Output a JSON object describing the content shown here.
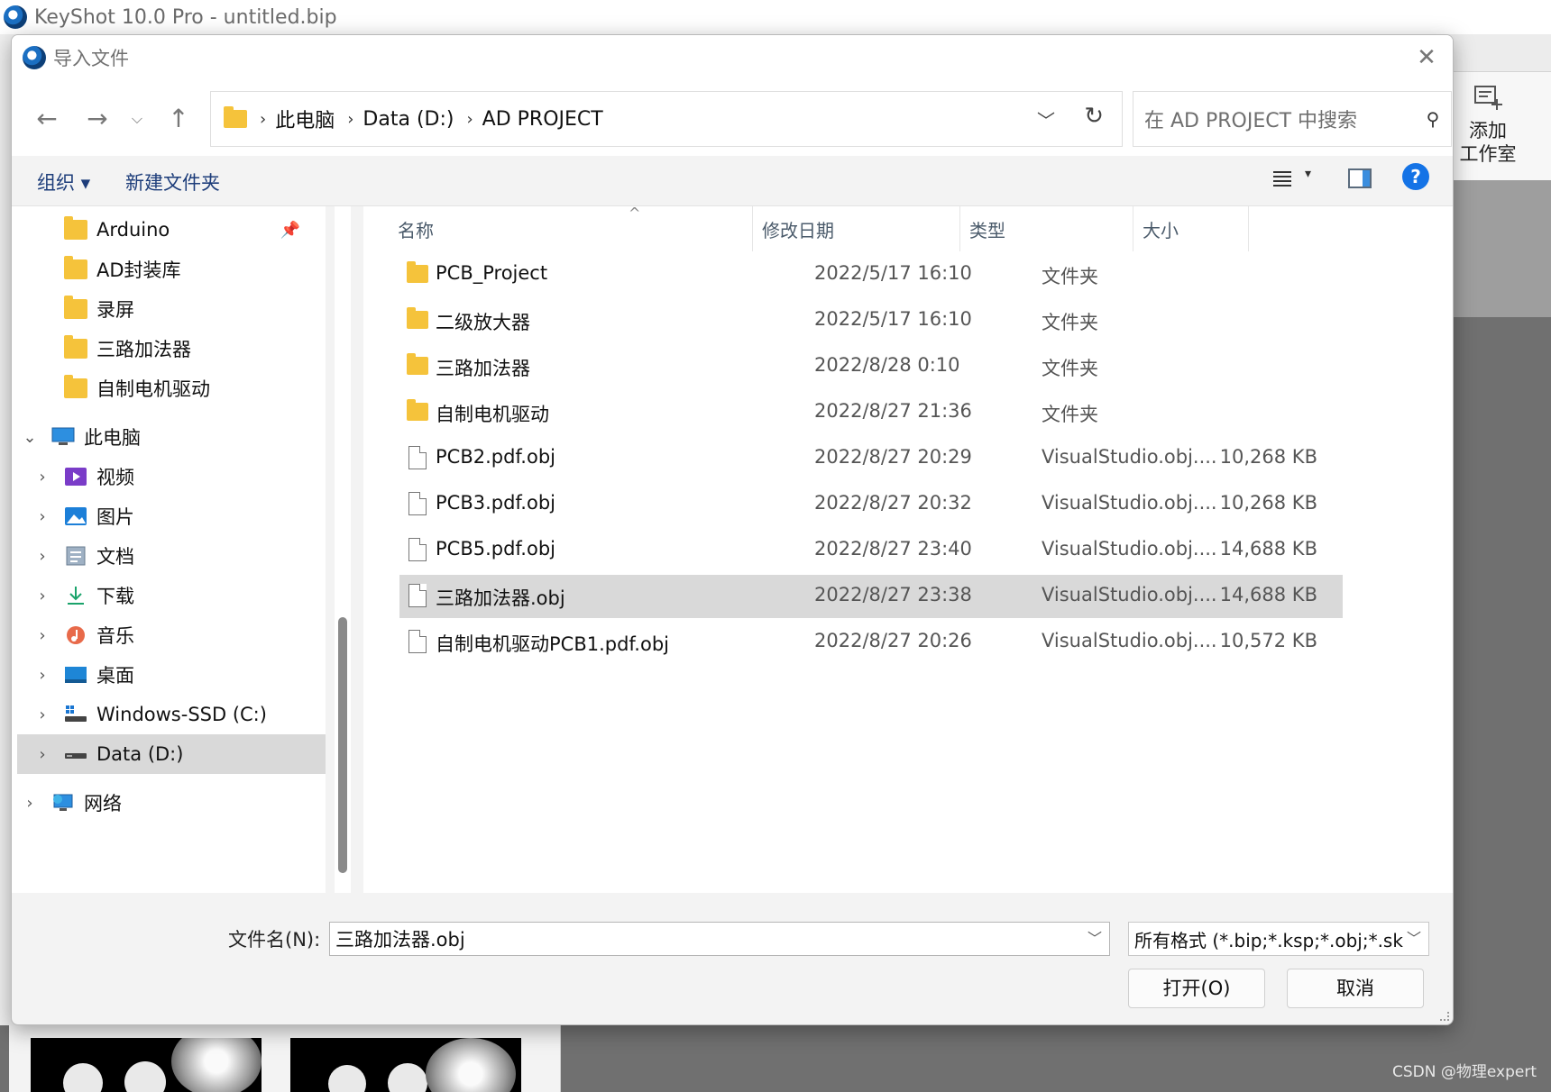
{
  "app": {
    "title": "KeyShot 10.0 Pro  - untitled.bip",
    "add_studio_label_1": "添加",
    "add_studio_label_2": "工作室",
    "watermark": "CSDN @物理expert"
  },
  "dialog": {
    "title": "导入文件",
    "breadcrumb": [
      "此电脑",
      "Data (D:)",
      "AD PROJECT"
    ],
    "search_placeholder": "在 AD PROJECT 中搜索",
    "commands": {
      "organize": "组织 ▾",
      "new_folder": "新建文件夹"
    },
    "nav_tree": [
      {
        "label": "Arduino",
        "icon": "folder-icon",
        "pinned": true
      },
      {
        "label": "AD封装库",
        "icon": "folder-icon"
      },
      {
        "label": "录屏",
        "icon": "folder-icon"
      },
      {
        "label": "三路加法器",
        "icon": "folder-icon"
      },
      {
        "label": "自制电机驱动",
        "icon": "folder-icon"
      },
      {
        "label": "此电脑",
        "icon": "computer-icon",
        "expanded": true
      },
      {
        "label": "视频",
        "icon": "video-icon"
      },
      {
        "label": "图片",
        "icon": "pictures-icon"
      },
      {
        "label": "文档",
        "icon": "documents-icon"
      },
      {
        "label": "下载",
        "icon": "download-icon"
      },
      {
        "label": "音乐",
        "icon": "music-icon"
      },
      {
        "label": "桌面",
        "icon": "desktop-icon"
      },
      {
        "label": "Windows-SSD (C:)",
        "icon": "windows-drive-icon"
      },
      {
        "label": "Data (D:)",
        "icon": "drive-icon",
        "selected": true
      },
      {
        "label": "网络",
        "icon": "network-icon"
      }
    ],
    "columns": [
      "名称",
      "修改日期",
      "类型",
      "大小"
    ],
    "files": [
      {
        "name": "PCB_Project",
        "date": "2022/5/17 16:10",
        "type": "文件夹",
        "size": "",
        "kind": "folder"
      },
      {
        "name": "二级放大器",
        "date": "2022/5/17 16:10",
        "type": "文件夹",
        "size": "",
        "kind": "folder"
      },
      {
        "name": "三路加法器",
        "date": "2022/8/28 0:10",
        "type": "文件夹",
        "size": "",
        "kind": "folder"
      },
      {
        "name": "自制电机驱动",
        "date": "2022/8/27 21:36",
        "type": "文件夹",
        "size": "",
        "kind": "folder"
      },
      {
        "name": "PCB2.pdf.obj",
        "date": "2022/8/27 20:29",
        "type": "VisualStudio.obj....",
        "size": "10,268 KB",
        "kind": "file"
      },
      {
        "name": "PCB3.pdf.obj",
        "date": "2022/8/27 20:32",
        "type": "VisualStudio.obj....",
        "size": "10,268 KB",
        "kind": "file"
      },
      {
        "name": "PCB5.pdf.obj",
        "date": "2022/8/27 23:40",
        "type": "VisualStudio.obj....",
        "size": "14,688 KB",
        "kind": "file"
      },
      {
        "name": "三路加法器.obj",
        "date": "2022/8/27 23:38",
        "type": "VisualStudio.obj....",
        "size": "14,688 KB",
        "kind": "file",
        "selected": true
      },
      {
        "name": "自制电机驱动PCB1.pdf.obj",
        "date": "2022/8/27 20:26",
        "type": "VisualStudio.obj....",
        "size": "10,572 KB",
        "kind": "file"
      }
    ],
    "filename_label": "文件名(N):",
    "filename_value": "三路加法器.obj",
    "filter_value": "所有格式 (*.bip;*.ksp;*.obj;*.sk",
    "open_label": "打开(O)",
    "cancel_label": "取消"
  }
}
